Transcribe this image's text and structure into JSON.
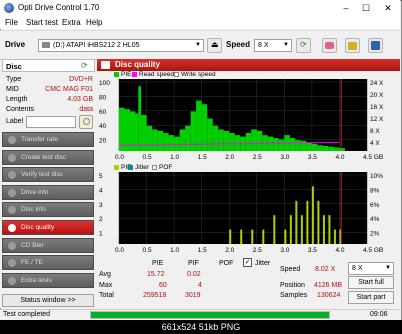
{
  "window": {
    "title": "Opti Drive Control 1.70",
    "minimize": "–",
    "maximize": "☐",
    "close": "✕"
  },
  "menu": [
    "File",
    "Start test",
    "Extra",
    "Help"
  ],
  "drive": {
    "label": "Drive",
    "value": "(D:)   ATAPI iHBS212   2 HL05",
    "speed_label": "Speed",
    "speed_value": "8 X"
  },
  "disc": {
    "header": "Disc",
    "props": [
      {
        "key": "Type",
        "value": "DVD+R"
      },
      {
        "key": "MID",
        "value": "CMC MAG F01"
      },
      {
        "key": "Length",
        "value": "4.03 GB"
      },
      {
        "key": "Contents",
        "value": "data"
      },
      {
        "key": "Label",
        "value": ""
      }
    ]
  },
  "nav": [
    "Transfer rate",
    "Create test disc",
    "Verify test disc",
    "Drive info",
    "Disc info",
    "Disc quality",
    "CD Bler",
    "FE / TE",
    "Extra tests"
  ],
  "status_window_btn": "Status window >>",
  "quality": {
    "title": "Disc quality",
    "legend_top": [
      "PIE",
      "Read speed",
      "Write speed"
    ],
    "legend_bottom": [
      "PIF",
      "Jitter",
      "POF"
    ],
    "colors": {
      "pie": "#00d000",
      "read": "#ff00ff",
      "write": "#ffffff",
      "pif": "#b0d000",
      "jitter": "#009090",
      "pof": "#ffffff",
      "accent": "#d9312c"
    }
  },
  "chart_data": [
    {
      "type": "area",
      "x_ticks": [
        "0.0",
        "0.5",
        "1.0",
        "1.5",
        "2.0",
        "2.5",
        "3.0",
        "3.5",
        "4.0",
        "4.5 GB"
      ],
      "y_left_ticks": [
        "100",
        "80",
        "60",
        "40",
        "20"
      ],
      "y_right_ticks": [
        "24 X",
        "20 X",
        "16 X",
        "12 X",
        "8 X",
        "4 X"
      ],
      "xlim": [
        0,
        4.5
      ],
      "ylim": [
        0,
        100
      ],
      "series": [
        {
          "name": "PIE",
          "x": [
            0.0,
            0.1,
            0.2,
            0.3,
            0.35,
            0.4,
            0.5,
            0.6,
            0.7,
            0.8,
            0.9,
            1.0,
            1.1,
            1.2,
            1.3,
            1.4,
            1.5,
            1.6,
            1.7,
            1.8,
            1.9,
            2.0,
            2.1,
            2.2,
            2.3,
            2.4,
            2.5,
            2.6,
            2.7,
            2.8,
            2.9,
            3.0,
            3.1,
            3.2,
            3.3,
            3.4,
            3.5,
            3.6,
            3.7,
            3.8,
            3.9,
            4.0
          ],
          "y": [
            60,
            58,
            55,
            52,
            90,
            50,
            35,
            30,
            28,
            25,
            22,
            20,
            30,
            35,
            55,
            70,
            65,
            45,
            35,
            30,
            28,
            25,
            22,
            20,
            25,
            30,
            28,
            22,
            20,
            18,
            16,
            22,
            18,
            15,
            14,
            12,
            10,
            8,
            7,
            6,
            5,
            4
          ]
        },
        {
          "name": "Read speed",
          "x": [
            0.0,
            4.0
          ],
          "y": [
            8,
            12
          ]
        }
      ]
    },
    {
      "type": "bar",
      "x_ticks": [
        "0.0",
        "0.5",
        "1.0",
        "1.5",
        "2.0",
        "2.5",
        "3.0",
        "3.5",
        "4.0",
        "4.5 GB"
      ],
      "y_left_ticks": [
        "5",
        "4",
        "3",
        "2",
        "1"
      ],
      "y_right_ticks": [
        "10%",
        "8%",
        "6%",
        "4%",
        "2%"
      ],
      "xlim": [
        0,
        4.5
      ],
      "ylim": [
        0,
        5
      ],
      "series": [
        {
          "name": "PIF",
          "x": [
            2.0,
            2.2,
            2.4,
            2.6,
            2.8,
            3.0,
            3.1,
            3.2,
            3.3,
            3.4,
            3.5,
            3.6,
            3.7,
            3.8,
            3.9,
            4.0
          ],
          "y": [
            1,
            1,
            1,
            1,
            2,
            1,
            2,
            3,
            2,
            3,
            4,
            3,
            2,
            2,
            1,
            1
          ]
        }
      ]
    }
  ],
  "stats": {
    "col_headers": [
      "PIE",
      "PIF",
      "POF"
    ],
    "jitter_label": "Jitter",
    "rows": [
      {
        "label": "Avg",
        "pie": "15.72",
        "pif": "0.02"
      },
      {
        "label": "Max",
        "pie": "60",
        "pif": "4"
      },
      {
        "label": "Total",
        "pie": "259518",
        "pif": "3019"
      }
    ],
    "speed_label": "Speed",
    "speed_value": "8.02 X",
    "position_label": "Position",
    "position_value": "4126 MB",
    "samples_label": "Samples",
    "samples_value": "130624",
    "speed_select": "8 X",
    "start_full": "Start full",
    "start_part": "Start part"
  },
  "statusbar": {
    "text": "Test completed",
    "time": "09:06"
  },
  "caption": "661x524  51kb  PNG"
}
